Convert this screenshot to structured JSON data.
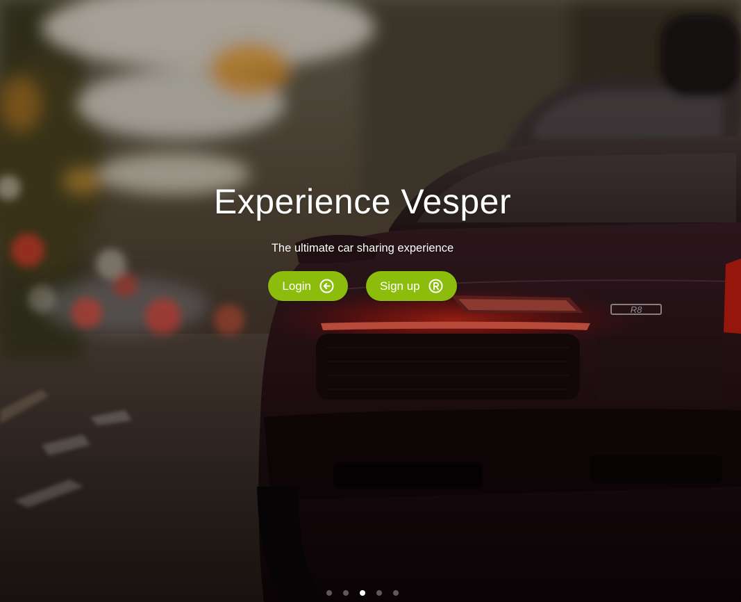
{
  "hero": {
    "title": "Experience Vesper",
    "subtitle": "The ultimate car sharing experience"
  },
  "buttons": {
    "login": {
      "label": "Login",
      "icon": "arrow-left-circle-icon"
    },
    "signup": {
      "label": "Sign up",
      "icon": "registered-circle-icon"
    }
  },
  "carousel": {
    "total": 5,
    "active_index": 2
  },
  "colors": {
    "accent": "#8dbd0c",
    "text": "#ffffff",
    "taillight": "#ff2a1a"
  }
}
